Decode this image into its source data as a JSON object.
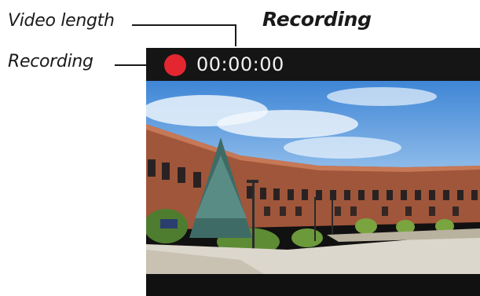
{
  "annotations": {
    "video_length_label": "Video length",
    "recording_label": "Recording",
    "title": "Recording"
  },
  "camera": {
    "timer": "00:00:00",
    "record_indicator_color": "#e3262f"
  }
}
